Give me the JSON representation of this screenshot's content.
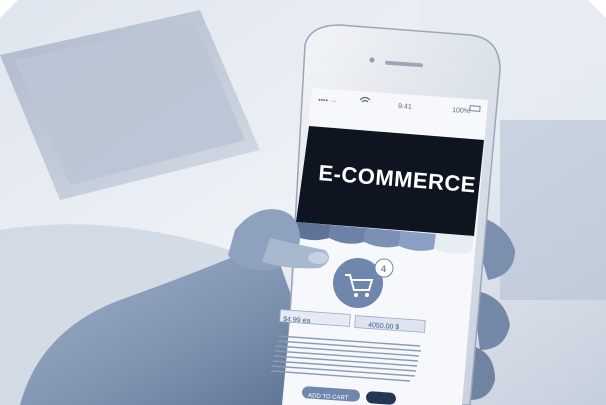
{
  "photo": {
    "banner_title": "E-COMMERCE",
    "cart_badge_count": "4",
    "status_bar": {
      "carrier": "•••• ···",
      "time": "9:41",
      "battery": "100%"
    },
    "left_field_text": "$4.99 ea",
    "right_field_text": "4050.00 $",
    "button_label": "ADD TO CART",
    "colors": {
      "tint": "#6f86ad",
      "banner_bg": "#0e1420",
      "cart_circle": "#6f86ad"
    },
    "icons": [
      "shopping-cart-icon",
      "wifi-icon",
      "battery-icon"
    ]
  }
}
